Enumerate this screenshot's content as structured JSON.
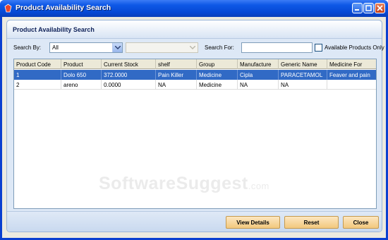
{
  "window": {
    "title": "Product Availability Search"
  },
  "panel": {
    "header": "Product Availability Search"
  },
  "filters": {
    "search_by_label": "Search By:",
    "search_by_value": "All",
    "search_for_label": "Search For:",
    "search_for_value": "",
    "available_only_label": "Available Products Only",
    "available_only_checked": false
  },
  "table": {
    "columns": [
      "Product Code",
      "Product",
      "Current Stock",
      "shelf",
      "Group",
      "Manufacture",
      "Generic Name",
      "Medicine For"
    ],
    "rows": [
      [
        "1",
        "Dolo 650",
        "372.0000",
        "Pain Killer",
        "Medicine",
        "Cipla",
        "PARACETAMOL",
        "Feaver and pain"
      ],
      [
        "2",
        "areno",
        "0.0000",
        "NA",
        "Medicine",
        "NA",
        "NA",
        ""
      ]
    ],
    "selected_row": 0
  },
  "buttons": {
    "view_details": "View Details",
    "reset": "Reset",
    "close": "Close"
  },
  "watermark": {
    "main": "SoftwareSuggest",
    "suffix": ".com"
  },
  "colors": {
    "titlebar": "#0648d4",
    "selection": "#316ac5",
    "button_fill": "#f2c87e"
  }
}
